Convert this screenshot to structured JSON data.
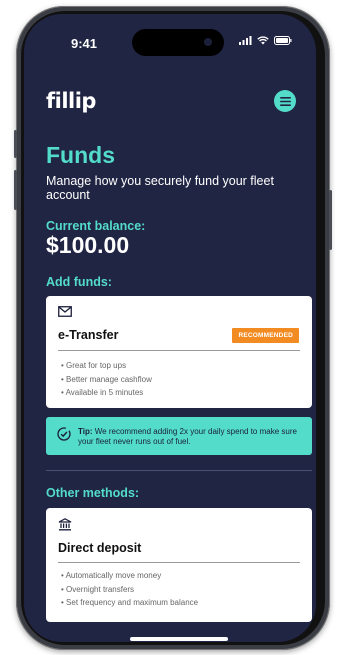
{
  "status_bar": {
    "time": "9:41"
  },
  "header": {
    "logo_text": "fillip",
    "menu_icon": "hamburger-icon"
  },
  "page": {
    "title": "Funds",
    "subtitle": "Manage how you securely fund your fleet account",
    "balance_label": "Current balance:",
    "balance_amount": "$100.00",
    "add_funds_label": "Add funds:",
    "other_methods_label": "Other methods:"
  },
  "etransfer_card": {
    "icon": "envelope-icon",
    "title": "e-Transfer",
    "badge": "RECOMMENDED",
    "bullets": [
      "Great for top ups",
      "Better manage cashflow",
      "Available in 5 minutes"
    ]
  },
  "tip": {
    "icon": "check-circle-icon",
    "label": "Tip:",
    "text": "We recommend adding 2x your daily spend to make sure your fleet never runs out of fuel."
  },
  "deposit_card": {
    "icon": "bank-icon",
    "title": "Direct deposit",
    "bullets": [
      "Automatically move money",
      "Overnight transfers",
      "Set frequency and maximum balance"
    ]
  },
  "colors": {
    "background": "#212544",
    "accent": "#52dcc9",
    "badge": "#f28b22",
    "card": "#ffffff"
  }
}
